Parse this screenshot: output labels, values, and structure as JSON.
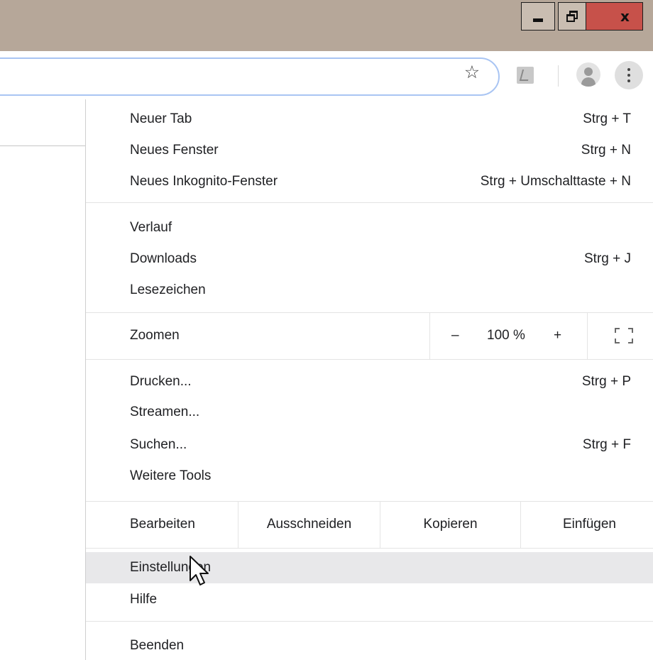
{
  "window_controls": {
    "minimize_glyph": "",
    "close_glyph": "x"
  },
  "toolbar": {
    "icons": [
      "star-icon",
      "pdf-extension-icon",
      "profile-avatar-icon",
      "more-vert-icon"
    ],
    "star_glyph": "☆"
  },
  "menu": {
    "group1": [
      {
        "label": "Neuer Tab",
        "shortcut": "Strg + T"
      },
      {
        "label": "Neues Fenster",
        "shortcut": "Strg + N"
      },
      {
        "label": "Neues Inkognito-Fenster",
        "shortcut": "Strg + Umschalttaste + N"
      }
    ],
    "group2": [
      {
        "label": "Verlauf",
        "shortcut": ""
      },
      {
        "label": "Downloads",
        "shortcut": "Strg + J"
      },
      {
        "label": "Lesezeichen",
        "shortcut": ""
      }
    ],
    "zoom": {
      "label": "Zoomen",
      "minus": "–",
      "value": "100 %",
      "plus": "+"
    },
    "group3": [
      {
        "label": "Drucken...",
        "shortcut": "Strg + P"
      },
      {
        "label": "Streamen...",
        "shortcut": ""
      },
      {
        "label": "Suchen...",
        "shortcut": "Strg + F"
      },
      {
        "label": "Weitere Tools",
        "shortcut": ""
      }
    ],
    "edit": {
      "label": "Bearbeiten",
      "cut": "Ausschneiden",
      "copy": "Kopieren",
      "paste": "Einfügen"
    },
    "group4": [
      {
        "label": "Einstellungen",
        "shortcut": ""
      },
      {
        "label": "Hilfe",
        "shortcut": ""
      }
    ],
    "exit": {
      "label": "Beenden"
    }
  },
  "colors": {
    "titlebar": "#b6a799",
    "close_button": "#c7514a",
    "omnibox_border": "#a9c5f3",
    "hover_row": "#e8e8ea"
  }
}
